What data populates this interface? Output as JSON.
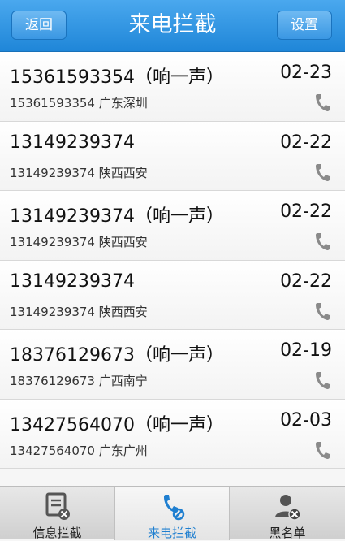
{
  "header": {
    "back_label": "返回",
    "title": "来电拦截",
    "settings_label": "设置"
  },
  "calls": [
    {
      "number": "15361593354",
      "tag": "（响一声）",
      "date": "02-23",
      "detail_number": "15361593354",
      "location": "广东深圳"
    },
    {
      "number": "13149239374",
      "tag": "",
      "date": "02-22",
      "detail_number": "13149239374",
      "location": "陕西西安"
    },
    {
      "number": "13149239374",
      "tag": "（响一声）",
      "date": "02-22",
      "detail_number": "13149239374",
      "location": "陕西西安"
    },
    {
      "number": "13149239374",
      "tag": "",
      "date": "02-22",
      "detail_number": "13149239374",
      "location": "陕西西安"
    },
    {
      "number": "18376129673",
      "tag": "（响一声）",
      "date": "02-19",
      "detail_number": "18376129673",
      "location": "广西南宁"
    },
    {
      "number": "13427564070",
      "tag": "（响一声）",
      "date": "02-03",
      "detail_number": "13427564070",
      "location": "广东广州"
    }
  ],
  "tabs": [
    {
      "label": "信息拦截",
      "icon": "message-block-icon",
      "active": false
    },
    {
      "label": "来电拦截",
      "icon": "phone-block-icon",
      "active": true
    },
    {
      "label": "黑名单",
      "icon": "blacklist-user-icon",
      "active": false
    }
  ],
  "colors": {
    "header": "#2b90e0",
    "active_tab_text": "#1f7fd0"
  }
}
